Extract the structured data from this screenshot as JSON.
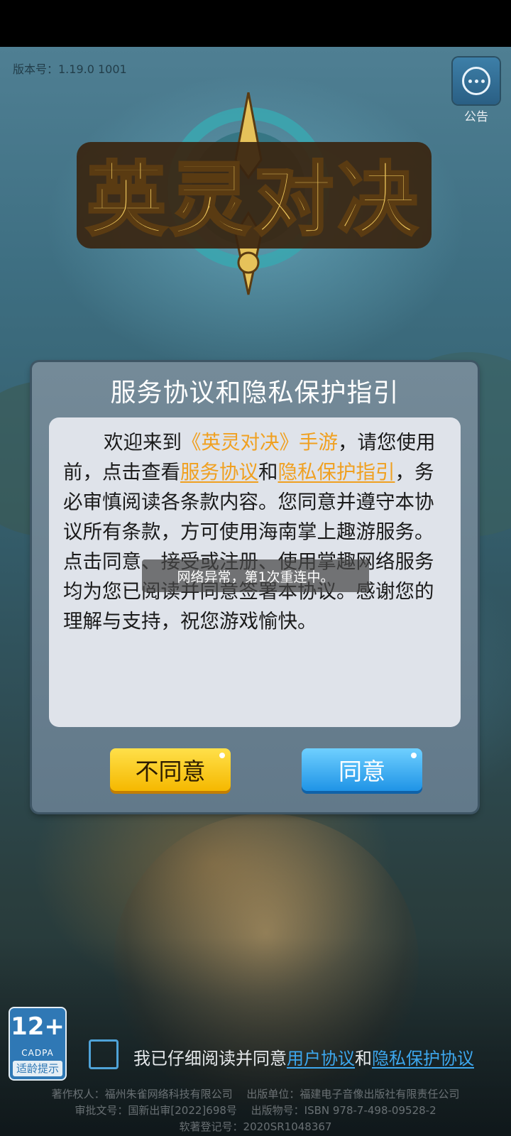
{
  "version": "版本号：1.19.0 1001",
  "notice": {
    "label": "公告"
  },
  "logo": {
    "text": "英灵对决"
  },
  "modal": {
    "title": "服务协议和隐私保护指引",
    "body": {
      "p1": "欢迎来到",
      "game_name": "《英灵对决》手游",
      "p2": "，请您使用前，点击查看",
      "link_service": "服务协议",
      "p3": "和",
      "link_privacy": "隐私保护指引",
      "p4": "，务必审慎阅读各条款内容。您同意并遵守本协议所有条款，方可使用海南掌上趣游服务。点击同意、接受或注册、使用掌趣网络服务均为您已阅读并同意签署本协议。感谢您的理解与支持，祝您游戏愉快。"
    },
    "disagree": "不同意",
    "agree": "同意"
  },
  "toast": "网络异常，第1次重连中。",
  "age_badge": {
    "rating": "12+",
    "org": "CADPA",
    "hint": "适龄提示"
  },
  "agreement": {
    "prefix": "我已仔细阅读并同意",
    "user_link": "用户协议",
    "and": "和",
    "privacy_link": "隐私保护协议",
    "checked": false
  },
  "copyright": [
    "著作权人：福州朱雀网络科技有限公司　 出版单位：福建电子音像出版社有限责任公司",
    "审批文号：国新出审[2022]698号　 出版物号：ISBN 978-7-498-09528-2",
    "软著登记号：2020SR1048367"
  ],
  "colors": {
    "highlight": "#f0a020",
    "link": "#3da7ee",
    "agree_btn": "#1f94e6",
    "disagree_btn": "#f5b800"
  }
}
